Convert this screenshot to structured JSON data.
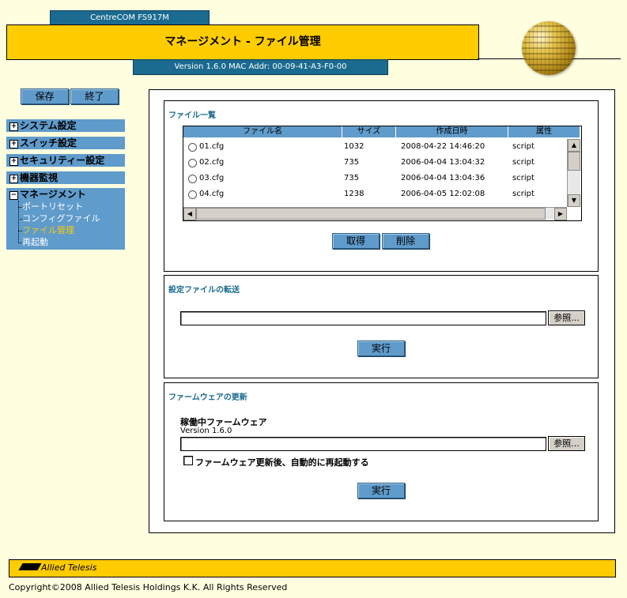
{
  "header": {
    "model": "CentreCOM FS917M",
    "title": "マネージメント - ファイル管理",
    "version": "Version 1.6.0 MAC Addr: 00-09-41-A3-F0-00"
  },
  "sidebar": {
    "save_label": "保存",
    "exit_label": "終了",
    "menus": [
      {
        "label": "システム設定",
        "sign": "+"
      },
      {
        "label": "スイッチ設定",
        "sign": "+"
      },
      {
        "label": "セキュリティー設定",
        "sign": "+"
      },
      {
        "label": "機器監視",
        "sign": "+"
      },
      {
        "label": "マネージメント",
        "sign": "−"
      }
    ],
    "sub_items": [
      "ポートリセット",
      "コンフィグファイル",
      "ファイル管理",
      "再起動"
    ],
    "active_color": "#ffcc00"
  },
  "file_list": {
    "title": "ファイル一覧",
    "columns": [
      "ファイル名",
      "サイズ",
      "作成日時",
      "属性"
    ],
    "rows": [
      {
        "name": "01.cfg",
        "size": "1032",
        "date": "2008-04-22 14:46:20",
        "attr": "script"
      },
      {
        "name": "02.cfg",
        "size": "735",
        "date": "2006-04-04 13:04:32",
        "attr": "script"
      },
      {
        "name": "03.cfg",
        "size": "735",
        "date": "2006-04-04 13:04:36",
        "attr": "script"
      },
      {
        "name": "04.cfg",
        "size": "1238",
        "date": "2006-04-05 12:02:08",
        "attr": "script"
      }
    ],
    "get_label": "取得",
    "delete_label": "削除"
  },
  "transfer": {
    "title": "設定ファイルの転送",
    "path_value": "",
    "browse_label": "参照...",
    "run_label": "実行"
  },
  "firmware": {
    "title": "ファームウェアの更新",
    "running_label": "稼働中ファームウェア",
    "running_version": "Version 1.6.0",
    "path_value": "",
    "browse_label": "参照...",
    "auto_reboot_label": "ファームウェア更新後、自動的に再起動する",
    "auto_reboot_checked": false,
    "run_label": "実行"
  },
  "footer": {
    "logo_text": "Allied Telesis",
    "copyright": "Copyright©2008 Allied Telesis Holdings K.K. All Rights Reserved"
  }
}
